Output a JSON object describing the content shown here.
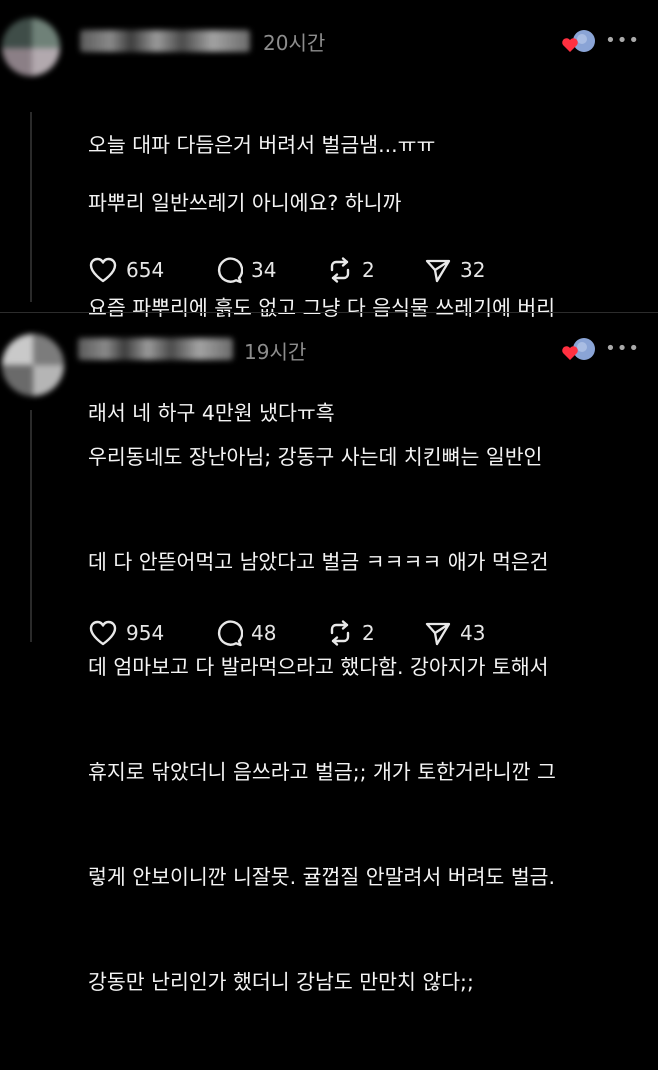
{
  "posts": [
    {
      "time": "20시간",
      "more": "•••",
      "first_line": "오늘 대파 다듬은거 버려서 벌금냄...ㅠㅠ",
      "body": [
        "파뿌리 일반쓰레기 아니에요? 하니까",
        "요즘 파뿌리에 흙도 없고 그냥 다 음식물 쓰레기에 버리",
        "래서 네 하구 4만원 냈다ㅠ흑"
      ],
      "likes": "654",
      "comments": "34",
      "reposts": "2",
      "shares": "32"
    },
    {
      "time": "19시간",
      "more": "•••",
      "body": [
        "우리동네도 장난아님; 강동구 사는데 치킨뼈는 일반인",
        "데 다 안뜯어먹고 남았다고 벌금 ㅋㅋㅋㅋ 애가 먹은건",
        "데 엄마보고 다 발라먹으라고 했다함. 강아지가 토해서",
        "휴지로 닦았더니 음쓰라고 벌금;; 개가 토한거라니깐 그",
        "렇게 안보이니깐 니잘못. 귤껍질 안말려서 버려도 벌금.",
        "강동만 난리인가 했더니 강남도 만만치 않다;;"
      ],
      "likes": "954",
      "comments": "48",
      "reposts": "2",
      "shares": "43"
    }
  ],
  "colors": {
    "heart": "#ff3040",
    "react_blue": "#8aa4d6"
  }
}
